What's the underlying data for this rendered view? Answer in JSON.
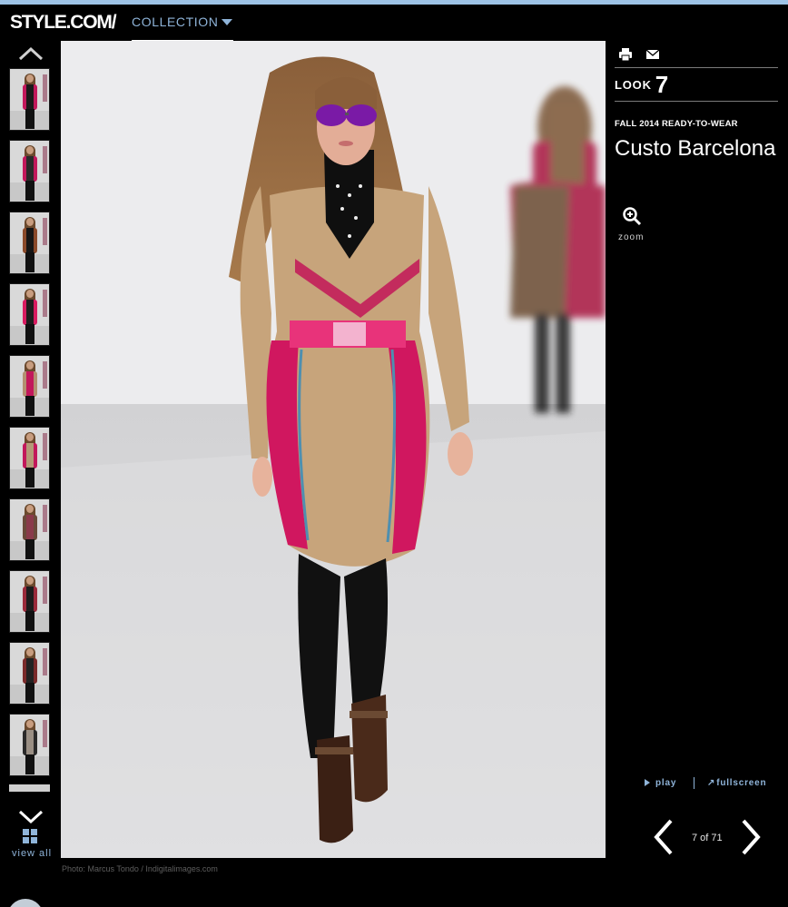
{
  "header": {
    "logo": "STYLE.COM/",
    "section": "COLLECTION"
  },
  "rail": {
    "view_all_label": "view all",
    "thumbnails": [
      {
        "label": "look 1",
        "outfit": "#1a1a1a",
        "accent": "#c2185b"
      },
      {
        "label": "look 2",
        "outfit": "#2a2a2a",
        "accent": "#c2185b"
      },
      {
        "label": "look 3",
        "outfit": "#161616",
        "accent": "#8a4a2a"
      },
      {
        "label": "look 4",
        "outfit": "#1e1e1e",
        "accent": "#d81b60"
      },
      {
        "label": "look 5",
        "outfit": "#c2185b",
        "accent": "#b39070"
      },
      {
        "label": "look 6",
        "outfit": "#b49a78",
        "accent": "#c2185b"
      },
      {
        "label": "look 7",
        "outfit": "#8a3a4a",
        "accent": "#6a4a3a"
      },
      {
        "label": "look 8",
        "outfit": "#1c1c1c",
        "accent": "#9a2a3a"
      },
      {
        "label": "look 9",
        "outfit": "#222222",
        "accent": "#7a2a2a"
      },
      {
        "label": "look 10",
        "outfit": "#9a8f84",
        "accent": "#2a2a2a"
      }
    ]
  },
  "photo": {
    "credit": "Photo: Marcus Tondo / Indigitalimages.com"
  },
  "panel": {
    "look_label": "LOOK",
    "look_number": "7",
    "season": "FALL 2014 READY-TO-WEAR",
    "designer": "Custo Barcelona",
    "zoom_label": "zoom",
    "play_label": "play",
    "fullscreen_label": "fullscreen",
    "counter": "7 of 71"
  },
  "colors": {
    "accent": "#8fb4d9",
    "background": "#000000",
    "top_strip": "#9ec3e6"
  },
  "icons": {
    "print": "printer-icon",
    "email": "envelope-icon",
    "zoom": "magnifier-plus-icon",
    "up": "chevron-up-icon",
    "down": "chevron-down-icon",
    "grid": "grid-icon",
    "prev": "chevron-left-icon",
    "next": "chevron-right-icon"
  }
}
